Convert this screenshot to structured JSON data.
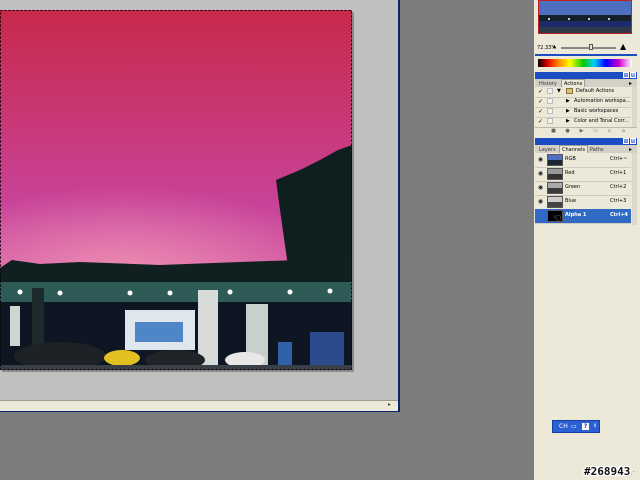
{
  "navigator": {
    "zoom": "72.33%",
    "slider_value": 0.55
  },
  "actions_panel": {
    "tabs": [
      "History",
      "Actions"
    ],
    "active_tab": "Actions",
    "items": [
      {
        "label": "Default Actions",
        "checked": true,
        "level": 0
      },
      {
        "label": "Automation workspa...",
        "checked": true,
        "level": 1
      },
      {
        "label": "Basic workspaces",
        "checked": true,
        "level": 1
      },
      {
        "label": "Color and Tonal Corr...",
        "checked": true,
        "level": 1
      }
    ]
  },
  "channels_panel": {
    "tabs": [
      "Layers",
      "Channels",
      "Paths"
    ],
    "active_tab": "Channels",
    "channels": [
      {
        "name": "RGB",
        "shortcut": "Ctrl+~",
        "selected": false
      },
      {
        "name": "Red",
        "shortcut": "Ctrl+1",
        "selected": false
      },
      {
        "name": "Green",
        "shortcut": "Ctrl+2",
        "selected": false
      },
      {
        "name": "Blue",
        "shortcut": "Ctrl+3",
        "selected": false
      },
      {
        "name": "Alpha 1",
        "shortcut": "Ctrl+4",
        "selected": true
      }
    ]
  },
  "language_bar": {
    "label": "CH",
    "help": "?"
  },
  "watermark": "#268943",
  "colors": {
    "titlebar": "#1b4cc2",
    "selection": "#316ac5",
    "panel_bg": "#ece9d8",
    "workspace": "#7c7c7c"
  }
}
